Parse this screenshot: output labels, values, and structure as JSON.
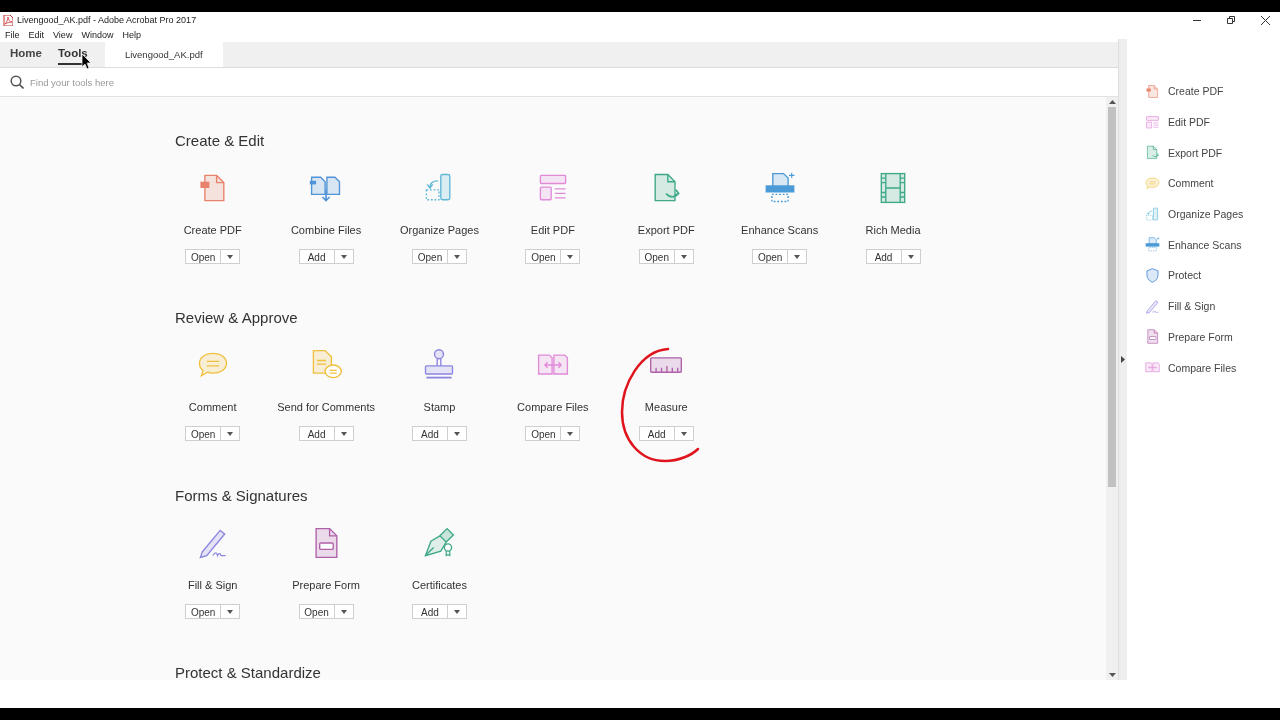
{
  "window": {
    "title": "Livengood_AK.pdf - Adobe Acrobat Pro 2017"
  },
  "menu": [
    "File",
    "Edit",
    "View",
    "Window",
    "Help"
  ],
  "tabs": [
    {
      "label": "Home",
      "selected": false
    },
    {
      "label": "Tools",
      "selected": true
    }
  ],
  "document_tab": {
    "label": "Livengood_AK.pdf"
  },
  "search": {
    "placeholder": "Find your tools here"
  },
  "sections": [
    {
      "title": "Create & Edit",
      "tools": [
        {
          "label": "Create PDF",
          "kind": "create",
          "button": "Open"
        },
        {
          "label": "Combine Files",
          "kind": "combine",
          "button": "Add"
        },
        {
          "label": "Organize Pages",
          "kind": "organize",
          "button": "Open"
        },
        {
          "label": "Edit PDF",
          "kind": "edit",
          "button": "Open"
        },
        {
          "label": "Export PDF",
          "kind": "export",
          "button": "Open"
        },
        {
          "label": "Enhance Scans",
          "kind": "enhance",
          "button": "Open"
        },
        {
          "label": "Rich Media",
          "kind": "media",
          "button": "Add"
        }
      ]
    },
    {
      "title": "Review & Approve",
      "tools": [
        {
          "label": "Comment",
          "kind": "comment",
          "button": "Open"
        },
        {
          "label": "Send for Comments",
          "kind": "send",
          "button": "Add"
        },
        {
          "label": "Stamp",
          "kind": "stamp",
          "button": "Add"
        },
        {
          "label": "Compare Files",
          "kind": "compare",
          "button": "Open"
        },
        {
          "label": "Measure",
          "kind": "measure",
          "button": "Add"
        }
      ]
    },
    {
      "title": "Forms & Signatures",
      "tools": [
        {
          "label": "Fill & Sign",
          "kind": "fillsign",
          "button": "Open"
        },
        {
          "label": "Prepare Form",
          "kind": "form",
          "button": "Open"
        },
        {
          "label": "Certificates",
          "kind": "certificate",
          "button": "Add"
        }
      ]
    },
    {
      "title": "Protect & Standardize"
    }
  ],
  "right_panel": {
    "items": [
      {
        "label": "Create PDF",
        "kind": "create"
      },
      {
        "label": "Edit PDF",
        "kind": "edit"
      },
      {
        "label": "Export PDF",
        "kind": "export"
      },
      {
        "label": "Comment",
        "kind": "comment"
      },
      {
        "label": "Organize Pages",
        "kind": "organize"
      },
      {
        "label": "Enhance Scans",
        "kind": "enhance"
      },
      {
        "label": "Protect",
        "kind": "protect"
      },
      {
        "label": "Fill & Sign",
        "kind": "fillsign"
      },
      {
        "label": "Prepare Form",
        "kind": "form"
      },
      {
        "label": "Compare Files",
        "kind": "compare"
      }
    ]
  }
}
